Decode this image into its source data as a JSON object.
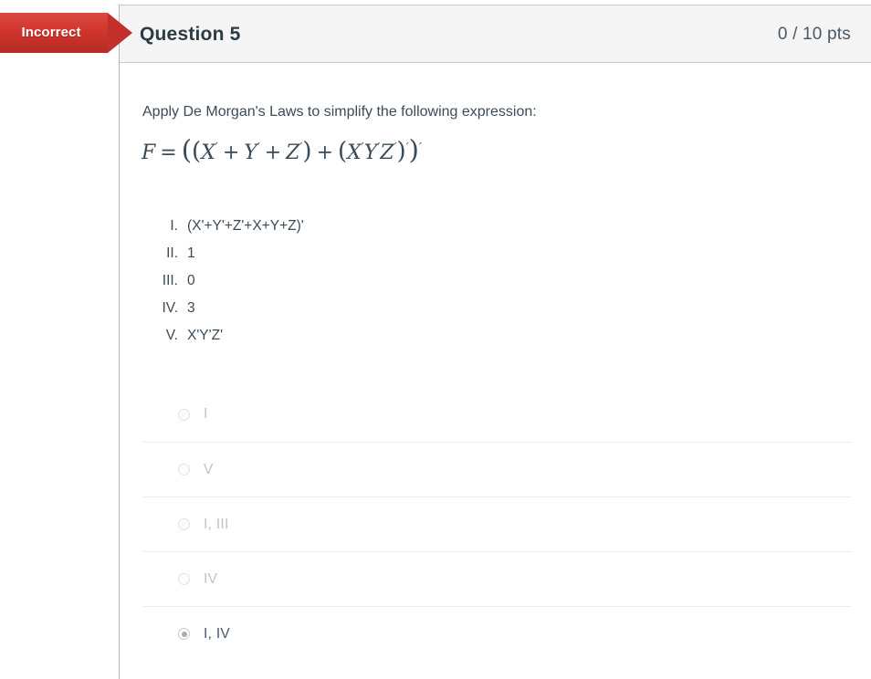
{
  "status_flag": {
    "label": "Incorrect",
    "color": "#c3302a"
  },
  "header": {
    "title": "Question 5",
    "points": "0 / 10 pts"
  },
  "question": {
    "prompt": "Apply De Morgan's Laws to simplify the following expression:",
    "expression_plain": "F = ((X' + Y' + Z') + (X'Y'Z')')'",
    "math": {
      "lhs": "F",
      "equals": "=",
      "terms": [
        "X",
        "Y",
        "Z",
        "X",
        "Y",
        "Z"
      ]
    }
  },
  "roman_list": [
    {
      "numeral": "I.",
      "value": "(X'+Y'+Z'+X+Y+Z)'"
    },
    {
      "numeral": "II.",
      "value": "1"
    },
    {
      "numeral": "III.",
      "value": "0"
    },
    {
      "numeral": "IV.",
      "value": "3"
    },
    {
      "numeral": "V.",
      "value": "X'Y'Z'"
    }
  ],
  "options": [
    {
      "label": "I",
      "selected": false
    },
    {
      "label": "V",
      "selected": false
    },
    {
      "label": "I, III",
      "selected": false
    },
    {
      "label": "IV",
      "selected": false
    },
    {
      "label": "I, IV",
      "selected": true
    }
  ]
}
